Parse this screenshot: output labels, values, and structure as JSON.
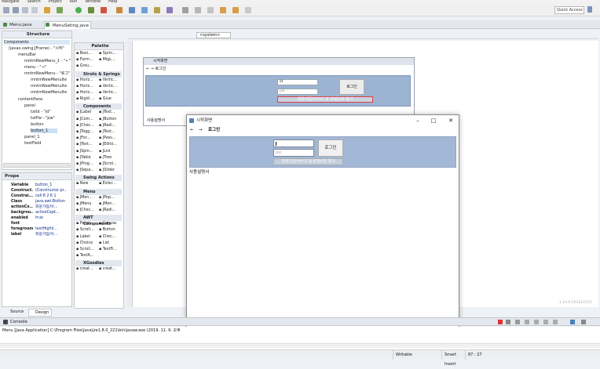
{
  "menubar": [
    "Navigate",
    "Search",
    "Project",
    "Run",
    "Window",
    "Help"
  ],
  "quick_access": "Quick Access",
  "editor_tabs": [
    "Menu.java",
    "MenuSeting.java"
  ],
  "structure": {
    "title": "Structure",
    "tree": [
      "Components",
      "(javax.swing.JFrame) - \"시작\"",
      "menuBar",
      "mntmNewMenu_1 - \"←\"",
      "menu - \"→\"",
      "mntmNewMenu - \"로그\"",
      "mntmNewMenuIte",
      "mntmNewMenuIte",
      "mntmNewMenuIte",
      "contentPane",
      "panel",
      "txtId - \"id\"",
      "txtPw - \"pw\"",
      "button",
      "button_1",
      "panel_1",
      "textField"
    ]
  },
  "palette": {
    "title": "Palette",
    "rows": [
      [
        "Boxi...",
        "Sprin..."
      ],
      [
        "Form...",
        "MigL..."
      ],
      [
        "Grou..."
      ],
      [
        "JLabel",
        "JText..."
      ],
      [
        "JCom...",
        "JButton"
      ],
      [
        "JChec...",
        "JRadi..."
      ],
      [
        "JTogg...",
        "JText..."
      ],
      [
        "JFor...",
        "JPass..."
      ],
      [
        "JText...",
        "JEdito..."
      ],
      [
        "JSpin...",
        "JList"
      ],
      [
        "JTable",
        "JTree"
      ],
      [
        "JProg...",
        "JScrol..."
      ],
      [
        "JSepa...",
        "JSlider"
      ],
      [
        "New",
        "Exter..."
      ],
      [
        "JMen...",
        "JPop..."
      ],
      [
        "JMenu",
        "JMen..."
      ],
      [
        "JChec...",
        "JRadi..."
      ],
      [
        "Panel",
        "Canvas"
      ],
      [
        "Scroll...",
        "Button"
      ],
      [
        "Label",
        "Chec..."
      ],
      [
        "Choice",
        "List"
      ],
      [
        "Scroll...",
        "TextFi..."
      ],
      [
        "TextA..."
      ],
      [
        "creat...",
        "creat..."
      ]
    ],
    "sections": [
      "Struts & Springs",
      "Components",
      "Swing Actions",
      "Menu",
      "AWT Components",
      "XGoodies"
    ],
    "struts_rows": [
      [
        "Horiz...",
        "Vertic..."
      ],
      [
        "Horiz...",
        "Vertic..."
      ],
      [
        "Horiz...",
        "Vertic..."
      ],
      [
        "Rigid ...",
        "Glue"
      ]
    ]
  },
  "properties": {
    "title": "Prope",
    "rows": [
      [
        "Variable",
        "button_1"
      ],
      [
        "Construct...",
        "(Constructor pr..."
      ],
      [
        "Constrai...",
        "cell 8 2 6 1"
      ],
      [
        "Class",
        "java.awt.Button"
      ],
      [
        "actionCo...",
        "회원가입/아..."
      ],
      [
        "backgrou...",
        "activeCapt..."
      ],
      [
        "enabled",
        "true"
      ],
      [
        "font",
        ""
      ],
      [
        "foreground",
        "textHighli..."
      ],
      [
        "label",
        "회원가입/아..."
      ]
    ]
  },
  "form": {
    "title": "시작화면",
    "nav": "← → 로그인",
    "id_value": "id",
    "pw_value": "pw",
    "login_btn": "로그인",
    "join_btn": "회원가입/아이디 및 비밀번호 찾기",
    "bottom_text": "사용설명서"
  },
  "run_window": {
    "title": "시작화면",
    "menu_back": "←",
    "menu_forward": "→",
    "menu_login": "로그인",
    "id_value": "",
    "pw_value": "pw",
    "login_btn": "로그인",
    "join_btn": "회원가입/아이디 및 비밀번호 찾기",
    "text_area": "사용설명서"
  },
  "bottom_tabs": [
    "Source",
    "Design"
  ],
  "console": {
    "title": "Console",
    "line": "Menu [Java Application] C:\\Program Files\\Java\\jre1.8.0_221\\bin\\javaw.exe (2019. 11. 9. 오후"
  },
  "version": "1.10.0.201612270",
  "status": {
    "writable": "Writable",
    "insert": "Smart Insert",
    "position": "87 : 27"
  }
}
